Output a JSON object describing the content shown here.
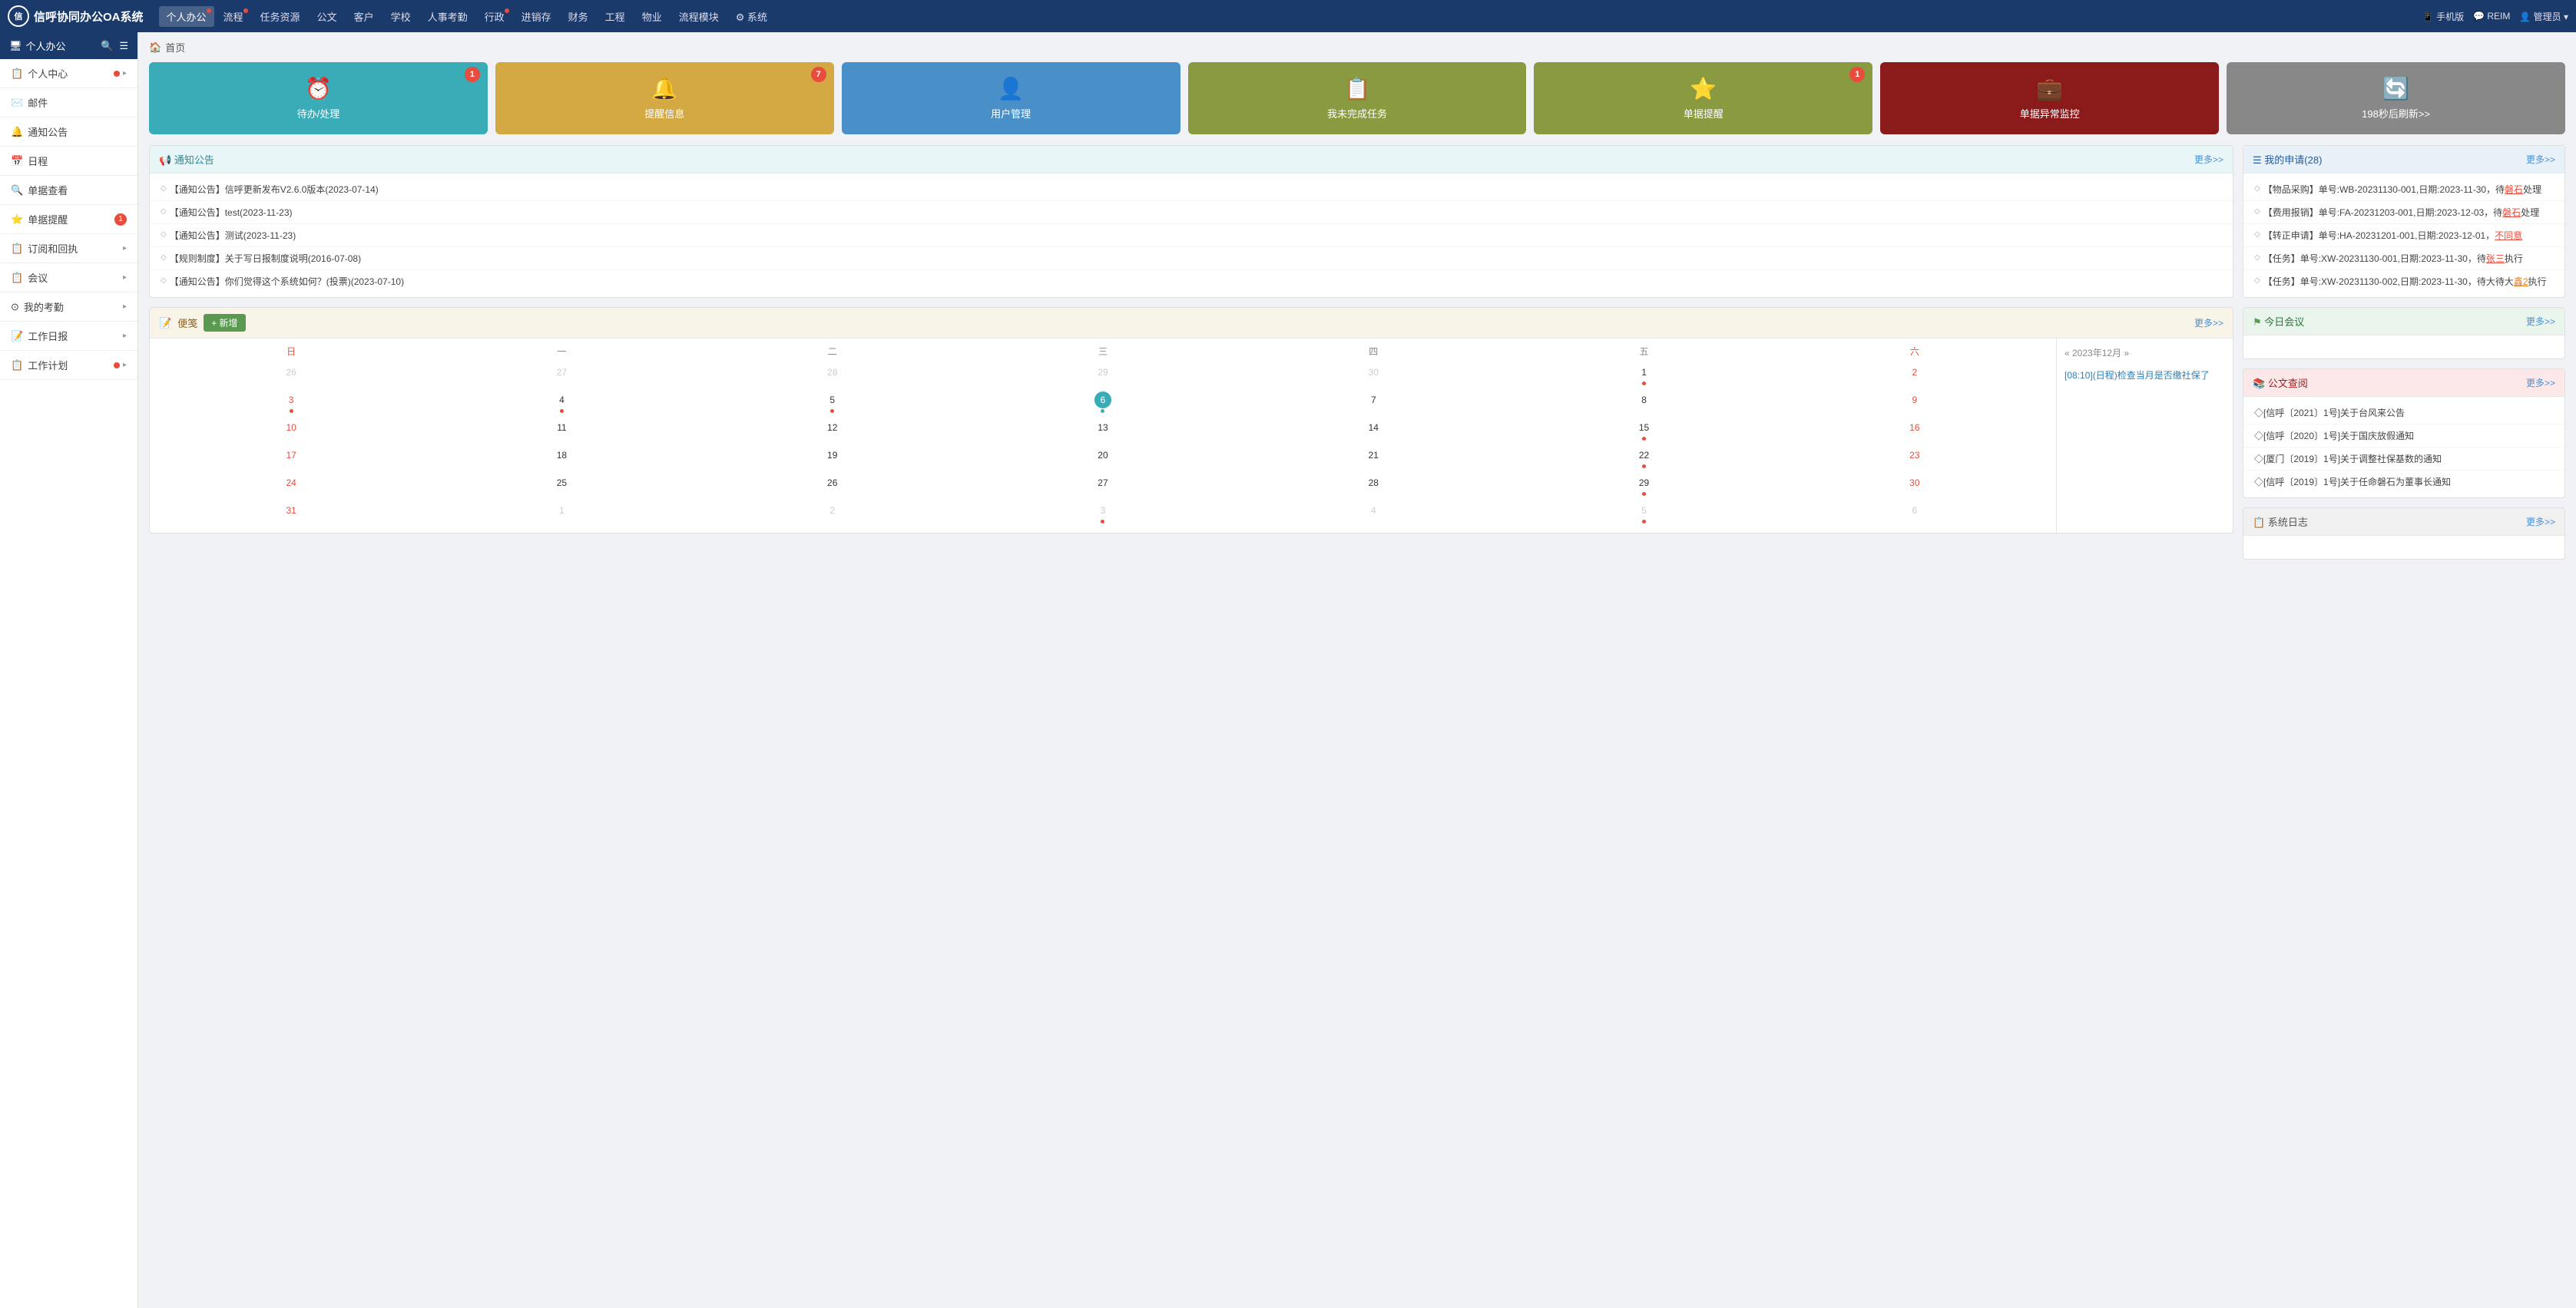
{
  "app": {
    "title": "信呼协同办公OA系统"
  },
  "topnav": {
    "logo_text": "信呼协同办公OA系统",
    "items": [
      {
        "label": "个人办公",
        "active": true,
        "dot": true
      },
      {
        "label": "流程",
        "dot": true
      },
      {
        "label": "任务资源"
      },
      {
        "label": "公文"
      },
      {
        "label": "客户"
      },
      {
        "label": "学校"
      },
      {
        "label": "人事考勤"
      },
      {
        "label": "行政",
        "dot": true
      },
      {
        "label": "进销存"
      },
      {
        "label": "财务"
      },
      {
        "label": "工程"
      },
      {
        "label": "物业"
      },
      {
        "label": "流程模块"
      },
      {
        "label": "系统",
        "gear": true
      }
    ],
    "right": [
      {
        "label": "手机版",
        "icon": "📱"
      },
      {
        "label": "REIM",
        "icon": "💬"
      },
      {
        "label": "管理员",
        "icon": "👤"
      }
    ]
  },
  "sidebar": {
    "header": "个人办公",
    "items": [
      {
        "label": "个人中心",
        "icon": "📋",
        "dot": true,
        "has_children": true
      },
      {
        "label": "邮件",
        "icon": "✉️",
        "has_children": false
      },
      {
        "label": "通知公告",
        "icon": "🔔",
        "has_children": false
      },
      {
        "label": "日程",
        "icon": "📅",
        "has_children": false
      },
      {
        "label": "单据查看",
        "icon": "🔍",
        "has_children": false
      },
      {
        "label": "单据提醒",
        "icon": "⭐",
        "badge": "1",
        "has_children": false
      },
      {
        "label": "订阅和回执",
        "icon": "📋",
        "has_children": true
      },
      {
        "label": "会议",
        "icon": "📋",
        "has_children": true
      },
      {
        "label": "我的考勤",
        "icon": "⊙",
        "has_children": true
      },
      {
        "label": "工作日报",
        "icon": "📝",
        "has_children": true
      },
      {
        "label": "工作计划",
        "icon": "📋",
        "dot": true,
        "has_children": true
      }
    ]
  },
  "breadcrumb": {
    "home_icon": "🏠",
    "label": "首页"
  },
  "dashboard_cards": [
    {
      "label": "待办/处理",
      "icon": "⏰",
      "badge": "1",
      "color": "teal"
    },
    {
      "label": "提醒信息",
      "icon": "🔔",
      "badge": "7",
      "color": "amber"
    },
    {
      "label": "用户管理",
      "icon": "👤",
      "badge": null,
      "color": "blue"
    },
    {
      "label": "我未完成任务",
      "icon": "📋",
      "badge": null,
      "color": "olive"
    },
    {
      "label": "单据提醒",
      "icon": "⭐",
      "badge": "1",
      "color": "olive"
    },
    {
      "label": "单据异常监控",
      "icon": "💼",
      "badge": null,
      "color": "darkred"
    },
    {
      "label": "198秒后刷新>>",
      "icon": "🔄",
      "badge": null,
      "color": "gray"
    }
  ],
  "notice_panel": {
    "title": "通知公告",
    "more": "更多>>",
    "items": [
      {
        "text": "【通知公告】信呼更新发布V2.6.0版本(2023-07-14)"
      },
      {
        "text": "【通知公告】test(2023-11-23)"
      },
      {
        "text": "【通知公告】测试(2023-11-23)"
      },
      {
        "text": "【规则制度】关于写日报制度说明(2016-07-08)"
      },
      {
        "text": "【通知公告】你们觉得这个系统如何？(投票)(2023-07-10)"
      }
    ]
  },
  "notepad": {
    "title": "便笺",
    "btn_add": "+ 新增",
    "more": "更多>>"
  },
  "calendar": {
    "year": "2023",
    "month": "12",
    "title": "« 2023年12月 »",
    "weekdays": [
      "日",
      "一",
      "二",
      "三",
      "四",
      "五",
      "六"
    ],
    "rows": [
      [
        {
          "num": "26",
          "other": true,
          "dot": false
        },
        {
          "num": "27",
          "other": true,
          "dot": false
        },
        {
          "num": "28",
          "other": true,
          "dot": false
        },
        {
          "num": "29",
          "other": true,
          "dot": false
        },
        {
          "num": "30",
          "other": true,
          "dot": false
        },
        {
          "num": "1",
          "dot": true
        },
        {
          "num": "2",
          "dot": false,
          "sat": true
        }
      ],
      [
        {
          "num": "3",
          "dot": true,
          "sun": true
        },
        {
          "num": "4",
          "dot": true
        },
        {
          "num": "5",
          "dot": true
        },
        {
          "num": "6",
          "today": true,
          "dot": true,
          "dot_blue": true
        },
        {
          "num": "7",
          "dot": false
        },
        {
          "num": "8",
          "dot": false
        },
        {
          "num": "9",
          "dot": false,
          "sat": true
        }
      ],
      [
        {
          "num": "10",
          "dot": false,
          "sun": true
        },
        {
          "num": "11",
          "dot": false
        },
        {
          "num": "12",
          "dot": false
        },
        {
          "num": "13",
          "dot": false
        },
        {
          "num": "14",
          "dot": false
        },
        {
          "num": "15",
          "dot": true
        },
        {
          "num": "16",
          "dot": false,
          "sat": true
        }
      ],
      [
        {
          "num": "17",
          "dot": false,
          "sun": true
        },
        {
          "num": "18",
          "dot": false
        },
        {
          "num": "19",
          "dot": false
        },
        {
          "num": "20",
          "dot": false
        },
        {
          "num": "21",
          "dot": false
        },
        {
          "num": "22",
          "dot": true
        },
        {
          "num": "23",
          "dot": false,
          "sat": true
        }
      ],
      [
        {
          "num": "24",
          "dot": false,
          "sun": true
        },
        {
          "num": "25",
          "dot": false
        },
        {
          "num": "26",
          "dot": false
        },
        {
          "num": "27",
          "dot": false
        },
        {
          "num": "28",
          "dot": false
        },
        {
          "num": "29",
          "dot": true
        },
        {
          "num": "30",
          "dot": false,
          "sat": true
        }
      ],
      [
        {
          "num": "31",
          "dot": false,
          "sun": true
        },
        {
          "num": "1",
          "other": true,
          "dot": false
        },
        {
          "num": "2",
          "other": true,
          "dot": false
        },
        {
          "num": "3",
          "other": true,
          "dot": true
        },
        {
          "num": "4",
          "other": true,
          "dot": false
        },
        {
          "num": "5",
          "other": true,
          "dot": true
        },
        {
          "num": "6",
          "other": true,
          "dot": false,
          "sat": true
        }
      ]
    ],
    "event_text": "[08:10](日程)检查当月是否缴社保了"
  },
  "my_applications": {
    "title": "我的申请(28)",
    "more": "更多>>",
    "items": [
      {
        "text": "【物品采购】单号:WB-20231130-001,日期:2023-11-30，待",
        "highlight": "磐石",
        "suffix": "处理"
      },
      {
        "text": "【费用报销】单号:FA-20231203-001,日期:2023-12-03，待",
        "highlight": "磐石",
        "suffix": "处理"
      },
      {
        "text": "【转正申请】单号:HA-20231201-001,日期:2023-12-01，",
        "highlight": "不同意",
        "suffix": ""
      },
      {
        "text": "【任务】单号:XW-20231130-001,日期:2023-11-30，待",
        "highlight": "张三",
        "suffix": "执行"
      },
      {
        "text": "【任务】单号:XW-20231130-002,日期:2023-11-30，待大",
        "highlight2": "鑫2",
        "suffix": "执行"
      }
    ]
  },
  "today_meeting": {
    "title": "今日会议",
    "more": "更多>>"
  },
  "document_query": {
    "title": "公文查阅",
    "more": "更多>>",
    "items": [
      {
        "text": "◇[信呼〔2021〕1号]关于台风来公告"
      },
      {
        "text": "◇[信呼〔2020〕1号]关于国庆放假通知"
      },
      {
        "text": "◇[厦门〔2019〕1号]关于调整社保基数的通知"
      },
      {
        "text": "◇[信呼〔2019〕1号]关于任命磐石为董事长通知"
      }
    ]
  },
  "system_log": {
    "title": "系统日志",
    "more": "更多>>"
  }
}
